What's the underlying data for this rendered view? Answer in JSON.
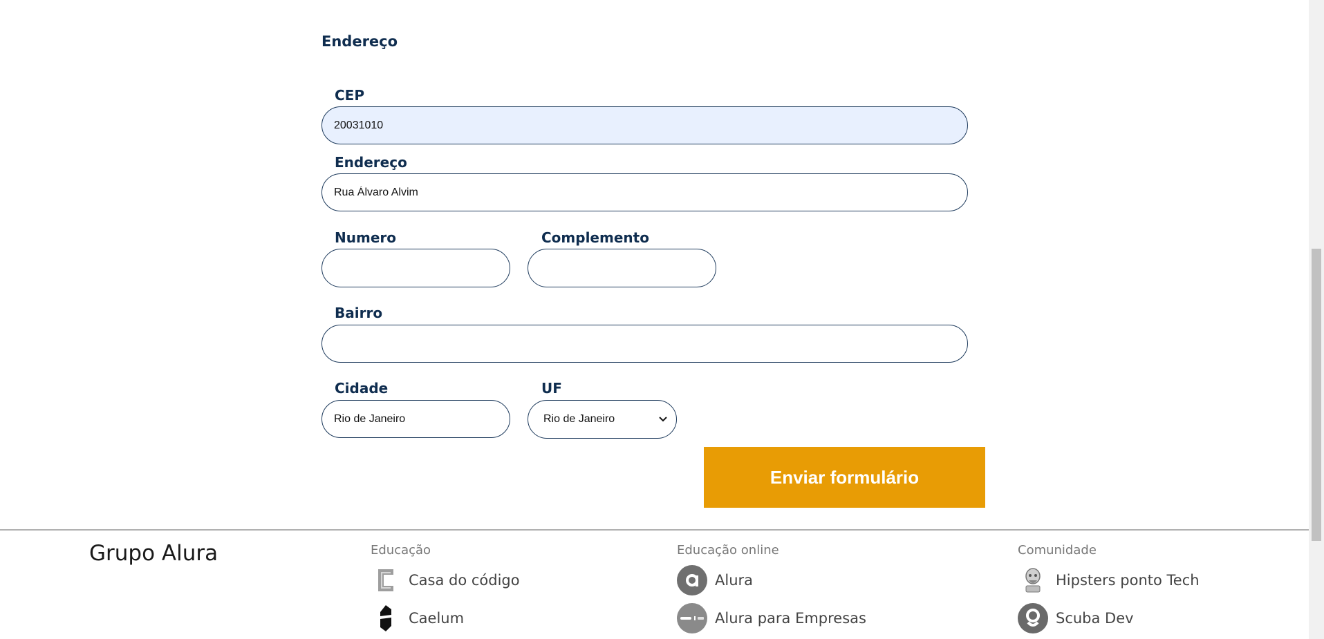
{
  "form": {
    "section_title": "Endereço",
    "cep": {
      "label": "CEP",
      "value": "20031010",
      "placeholder": ""
    },
    "endereco": {
      "label": "Endereço",
      "value": "Rua Álvaro Alvim",
      "placeholder": ""
    },
    "numero": {
      "label": "Numero",
      "value": "",
      "placeholder": ""
    },
    "complemento": {
      "label": "Complemento",
      "value": "",
      "placeholder": ""
    },
    "bairro": {
      "label": "Bairro",
      "value": "",
      "placeholder": ""
    },
    "cidade": {
      "label": "Cidade",
      "value": "Rio de Janeiro",
      "placeholder": ""
    },
    "uf": {
      "label": "UF",
      "selected": "Rio de Janeiro"
    },
    "submit_label": "Enviar formulário",
    "colors": {
      "label": "#0f2d4f",
      "border": "#1d3a5c",
      "autofill_bg": "#e8f0fe",
      "submit_bg": "#e89c05",
      "submit_text": "#ffffff"
    }
  },
  "footer": {
    "brand": "Grupo Alura",
    "columns": [
      {
        "heading": "Educação",
        "links": [
          {
            "label": "Casa do código",
            "icon": "casa-do-codigo-logo-icon"
          },
          {
            "label": "Caelum",
            "icon": "caelum-logo-icon"
          }
        ]
      },
      {
        "heading": "Educação online",
        "links": [
          {
            "label": "Alura",
            "icon": "alura-logo-icon"
          },
          {
            "label": "Alura para Empresas",
            "icon": "alura-empresas-logo-icon"
          }
        ]
      },
      {
        "heading": "Comunidade",
        "links": [
          {
            "label": "Hipsters ponto Tech",
            "icon": "hipsters-logo-icon"
          },
          {
            "label": "Scuba Dev",
            "icon": "scuba-dev-logo-icon"
          }
        ]
      }
    ]
  }
}
